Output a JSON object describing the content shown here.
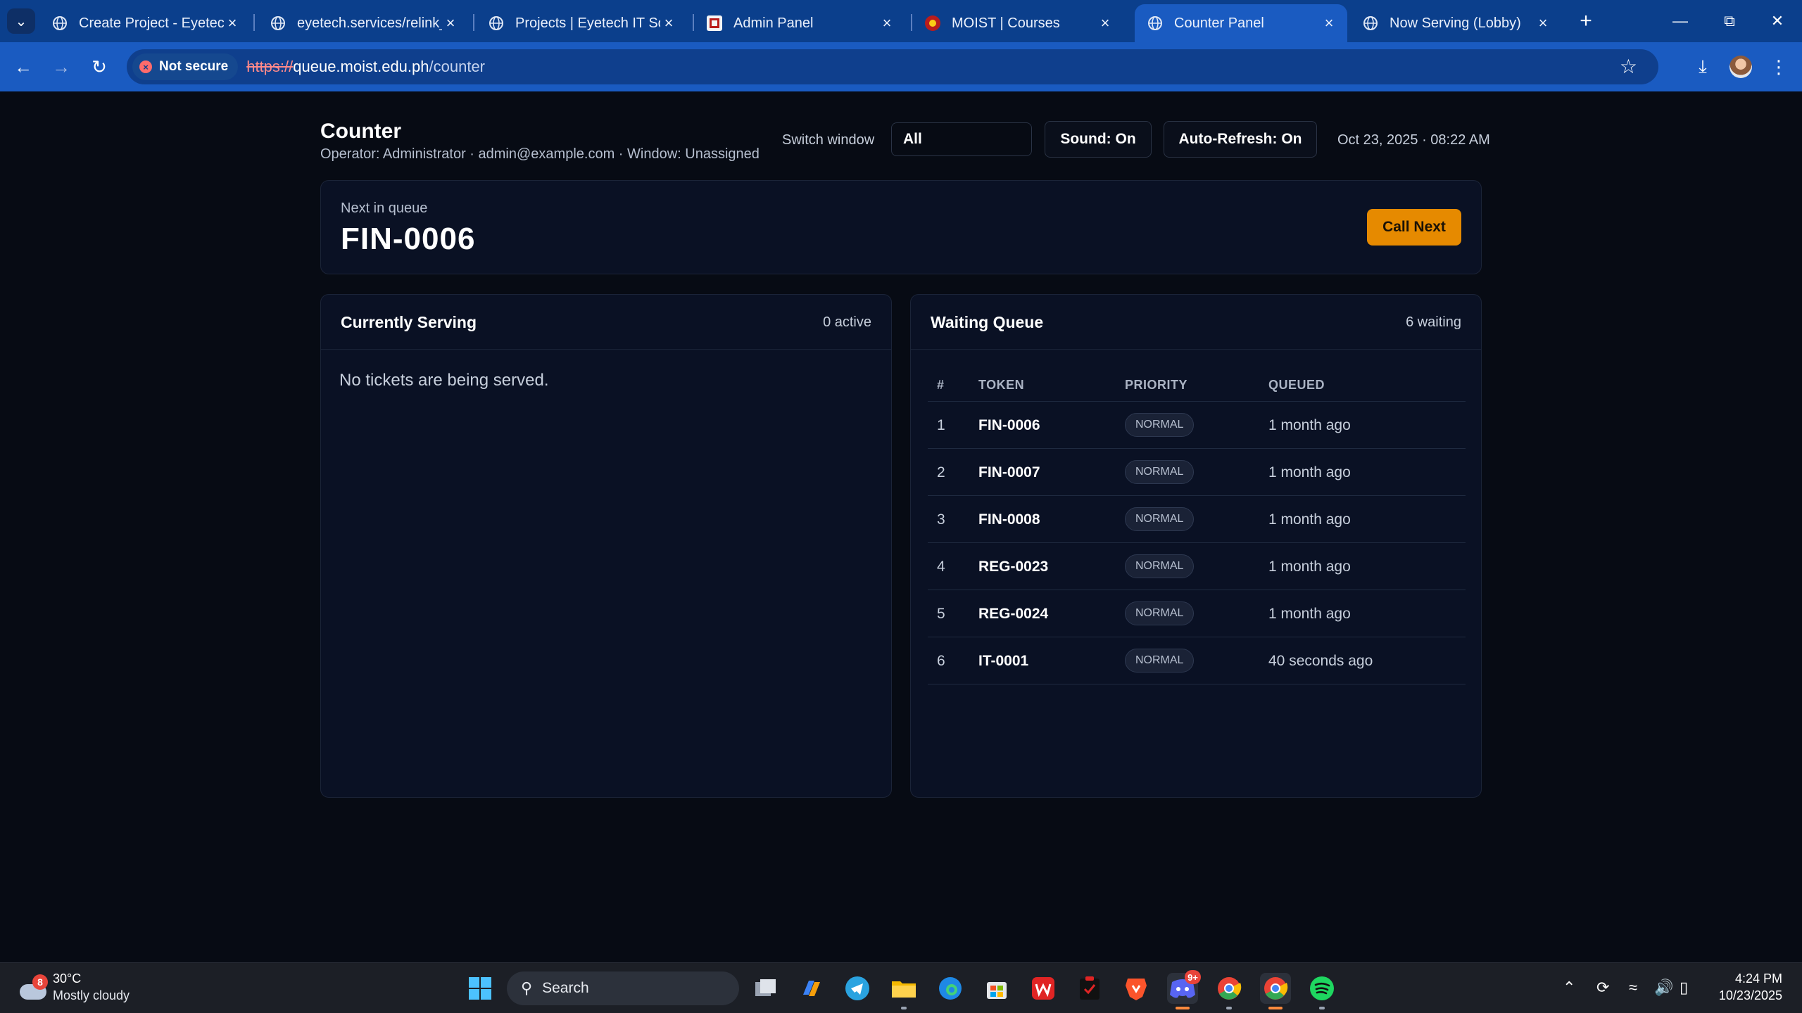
{
  "browser": {
    "tabs": [
      {
        "title": "Create Project - Eyetech A"
      },
      {
        "title": "eyetech.services/relink_sto"
      },
      {
        "title": "Projects | Eyetech IT Soluti"
      },
      {
        "title": "Admin Panel"
      },
      {
        "title": "MOIST | Courses"
      },
      {
        "title": "Counter Panel"
      },
      {
        "title": "Now Serving (Lobby)"
      }
    ],
    "security_label": "Not secure",
    "url_scheme": "https://",
    "url_host": "queue.moist.edu.ph",
    "url_path": "/counter"
  },
  "header": {
    "title": "Counter",
    "subtitle": "Operator: Administrator · admin@example.com · Window: Unassigned",
    "switch_window_label": "Switch window",
    "window_selected": "All",
    "sound_label": "Sound: On",
    "auto_refresh_label": "Auto-Refresh: On",
    "datetime": "Oct 23, 2025 · 08:22 AM"
  },
  "next": {
    "label": "Next in queue",
    "token": "FIN-0006",
    "call_button": "Call Next"
  },
  "serving": {
    "title": "Currently Serving",
    "count": "0 active",
    "empty_message": "No tickets are being served."
  },
  "queue": {
    "title": "Waiting Queue",
    "count": "6 waiting",
    "columns": [
      "#",
      "TOKEN",
      "PRIORITY",
      "QUEUED"
    ],
    "rows": [
      {
        "num": "1",
        "token": "FIN-0006",
        "priority": "NORMAL",
        "queued": "1 month ago"
      },
      {
        "num": "2",
        "token": "FIN-0007",
        "priority": "NORMAL",
        "queued": "1 month ago"
      },
      {
        "num": "3",
        "token": "FIN-0008",
        "priority": "NORMAL",
        "queued": "1 month ago"
      },
      {
        "num": "4",
        "token": "REG-0023",
        "priority": "NORMAL",
        "queued": "1 month ago"
      },
      {
        "num": "5",
        "token": "REG-0024",
        "priority": "NORMAL",
        "queued": "1 month ago"
      },
      {
        "num": "6",
        "token": "IT-0001",
        "priority": "NORMAL",
        "queued": "40 seconds ago"
      }
    ]
  },
  "taskbar": {
    "weather_badge": "8",
    "temperature": "30°C",
    "weather": "Mostly cloudy",
    "search_label": "Search",
    "discord_badge": "9+",
    "time": "4:24 PM",
    "date": "10/23/2025"
  },
  "colors": {
    "accent_orange": "#e68a00",
    "chrome_blue": "#1a5bc1",
    "page_bg": "#070b14",
    "card_bg": "#0a1124"
  }
}
